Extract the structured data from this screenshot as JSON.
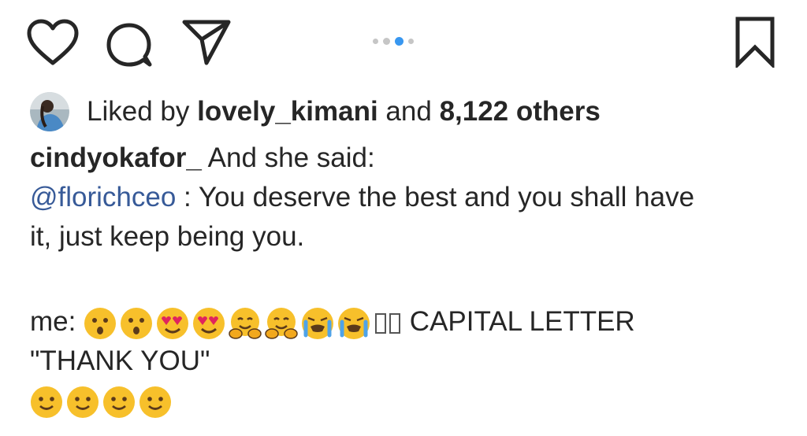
{
  "actions": {
    "like_icon": "heart-outline-icon",
    "comment_icon": "speech-bubble-icon",
    "share_icon": "paper-plane-icon",
    "save_icon": "bookmark-outline-icon"
  },
  "carousel": {
    "dots": 4,
    "active_index": 2,
    "active_color": "#3897f0"
  },
  "likes": {
    "prefix": "Liked by",
    "user": "lovely_kimani",
    "and": "and",
    "others": "8,122 others"
  },
  "caption": {
    "username": "cindyokafor_",
    "line1_text": " And she said:",
    "mention": "@florichceo",
    "line2_text": " : You deserve the best and you shall have",
    "line3_text": "it, just keep being you.",
    "line4_prefix": "me: ",
    "line4_suffix": " CAPITAL LETTER",
    "line5_text": "\"THANK YOU\""
  },
  "colors": {
    "text": "#262626",
    "mention": "#375a98",
    "dot_inactive": "#c6c6c6",
    "emoji_yellow": "#f7c02b"
  }
}
